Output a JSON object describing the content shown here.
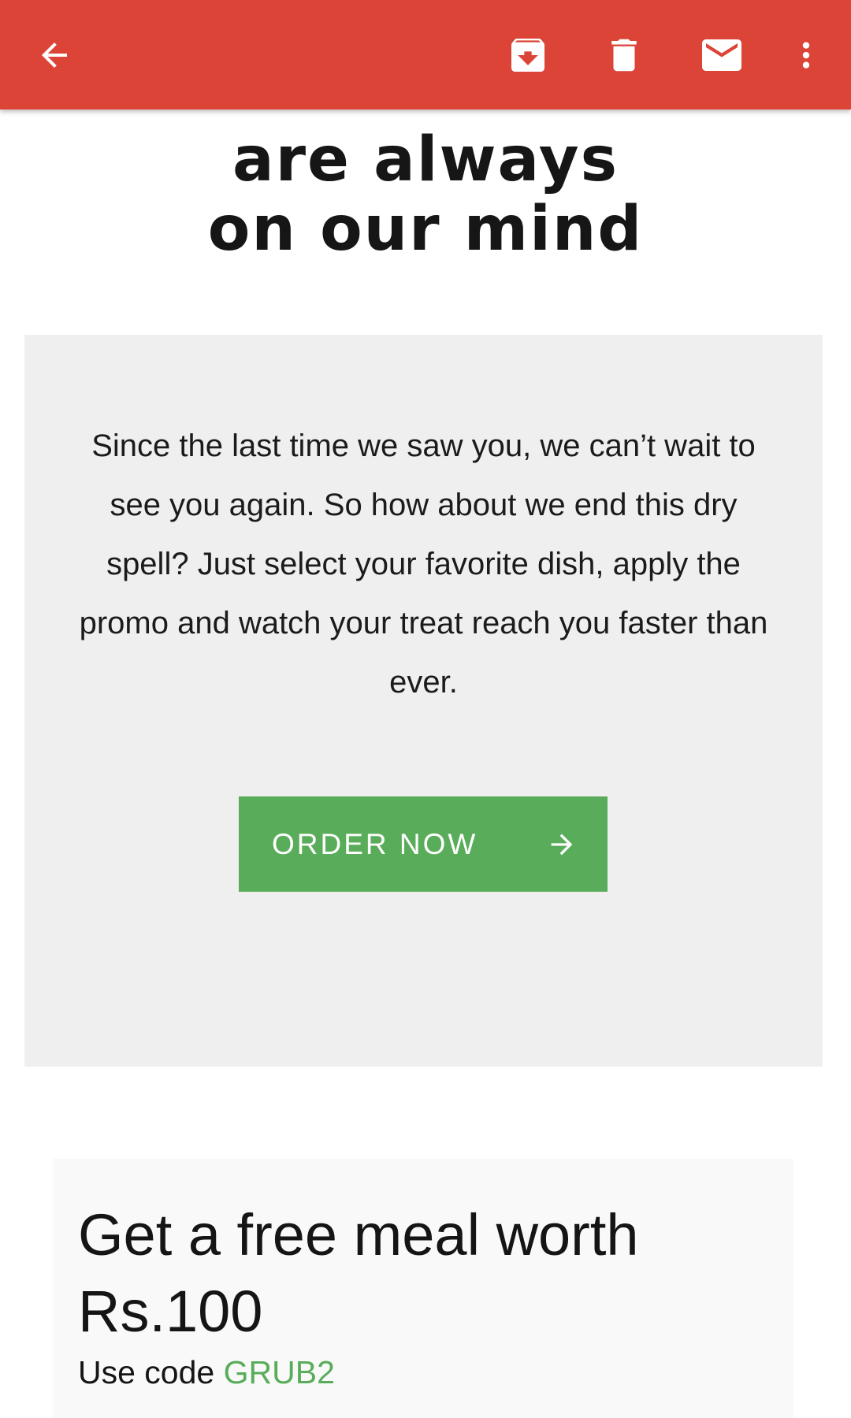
{
  "toolbar": {
    "color": "#db4437",
    "icons": {
      "back": "arrow-back-icon",
      "archive": "archive-icon",
      "delete": "trash-icon",
      "mark_unread": "mail-icon",
      "more": "more-vert-icon"
    }
  },
  "email": {
    "headline": {
      "line1": "are always",
      "line2": "on our mind"
    },
    "body": "Since the last time we saw you, we can’t wait to see you again. So how about we end this dry spell? Just select your favorite dish, apply the promo and watch your treat reach you faster than ever.",
    "cta": {
      "label": "ORDER NOW",
      "icon": "arrow-right-icon",
      "color": "#59ad5a"
    },
    "promo": {
      "title": "Get a free meal worth Rs.100",
      "code_prefix": "Use code ",
      "code": "GRUB2"
    }
  }
}
